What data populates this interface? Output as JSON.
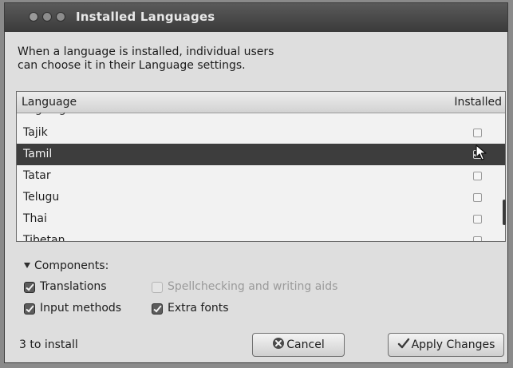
{
  "window": {
    "title": "Installed Languages"
  },
  "description": {
    "line1": "When a language is installed, individual users",
    "line2": "can choose it in their Language settings."
  },
  "list": {
    "header_language": "Language",
    "header_installed": "Installed",
    "rows": [
      {
        "name": "Tajik",
        "installed": false,
        "selected": false
      },
      {
        "name": "Tamil",
        "installed": true,
        "selected": true
      },
      {
        "name": "Tatar",
        "installed": false,
        "selected": false
      },
      {
        "name": "Telugu",
        "installed": false,
        "selected": false
      },
      {
        "name": "Thai",
        "installed": false,
        "selected": false
      },
      {
        "name": "Tibetan",
        "installed": false,
        "selected": false
      }
    ]
  },
  "components": {
    "header": "Components:",
    "translations": {
      "label": "Translations",
      "checked": true,
      "enabled": true
    },
    "spellchecking": {
      "label": "Spellchecking and writing aids",
      "checked": false,
      "enabled": false
    },
    "input_methods": {
      "label": "Input methods",
      "checked": true,
      "enabled": true
    },
    "extra_fonts": {
      "label": "Extra fonts",
      "checked": true,
      "enabled": true
    }
  },
  "footer": {
    "status": "3 to install",
    "cancel_label": "Cancel",
    "apply_label": "Apply Changes"
  }
}
